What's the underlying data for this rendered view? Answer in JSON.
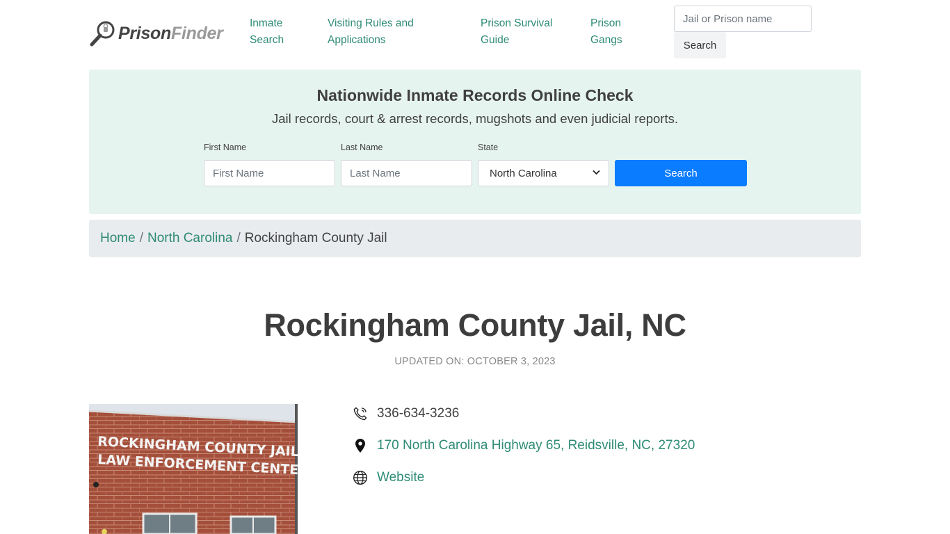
{
  "header": {
    "logo": {
      "part1": "Prison",
      "part2": "Finder"
    },
    "nav": [
      {
        "line1": "Inmate",
        "line2": "Search"
      },
      {
        "line1": "Visiting Rules and",
        "line2": "Applications"
      },
      {
        "line1": "Prison Survival",
        "line2": "Guide"
      },
      {
        "line1": "Prison",
        "line2": "Gangs"
      }
    ],
    "search": {
      "placeholder": "Jail or Prison name",
      "button": "Search"
    }
  },
  "panel": {
    "title": "Nationwide Inmate Records Online Check",
    "subtitle": "Jail records, court & arrest records, mugshots and even judicial reports.",
    "first_name": {
      "label": "First Name",
      "placeholder": "First Name"
    },
    "last_name": {
      "label": "Last Name",
      "placeholder": "Last Name"
    },
    "state": {
      "label": "State",
      "selected": "North Carolina"
    },
    "button": "Search"
  },
  "breadcrumb": {
    "home": "Home",
    "sep": "/",
    "state": "North Carolina",
    "current": "Rockingham County Jail"
  },
  "page": {
    "title": "Rockingham County Jail, NC",
    "updated": "UPDATED ON: OCTOBER 3, 2023"
  },
  "photo": {
    "sign_line1": "ROCKINGHAM COUNTY JAIL &",
    "sign_line2": "LAW ENFORCEMENT CENTER"
  },
  "contact": {
    "phone": "336-634-3236",
    "address": "170 North Carolina Highway 65, Reidsville, NC, 27320",
    "website": "Website"
  },
  "colors": {
    "accent": "#2e8b75",
    "primary_button": "#0a7cff",
    "panel_bg": "#e6f4f0",
    "breadcrumb_bg": "#e9ecef"
  },
  "icons": [
    "magnifier-logo-icon",
    "phone-icon",
    "map-pin-icon",
    "globe-icon",
    "chevron-down-icon"
  ]
}
